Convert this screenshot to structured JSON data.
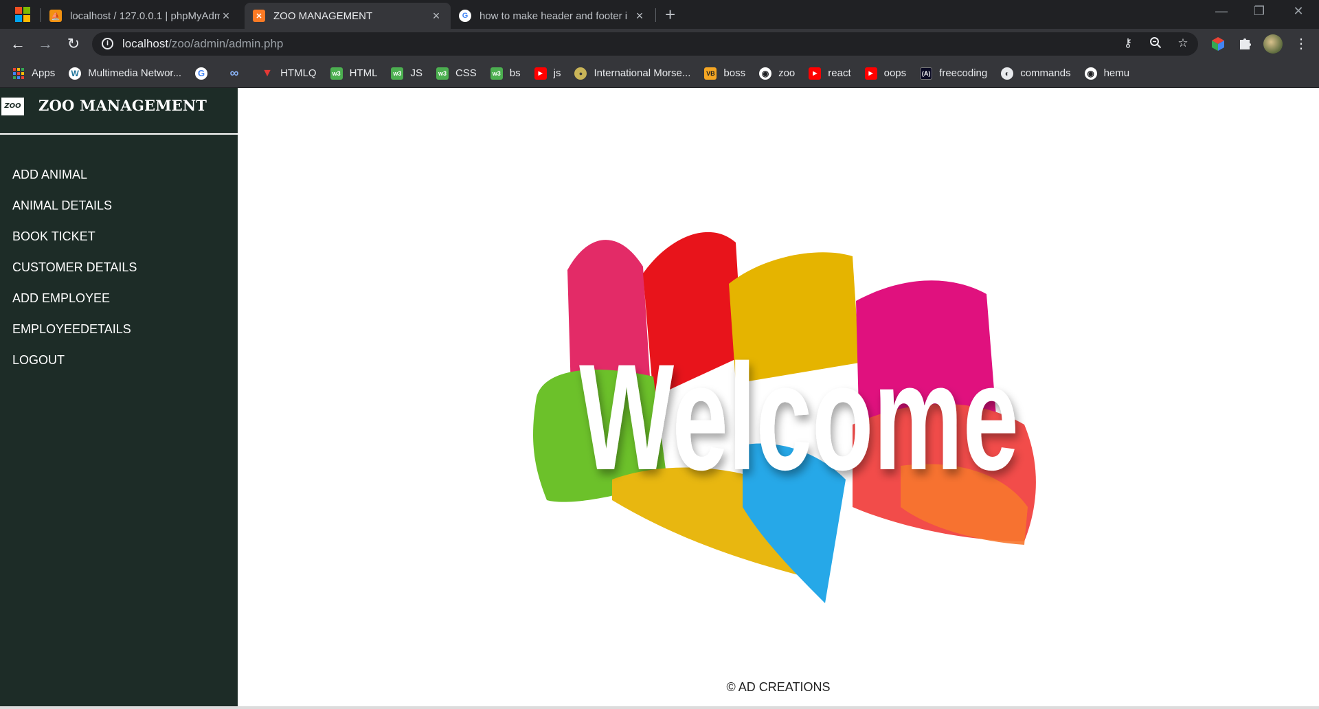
{
  "browser": {
    "tabs": [
      {
        "title": "localhost / 127.0.0.1 | phpMyAdm",
        "icon": "phpmyadmin-icon",
        "active": false
      },
      {
        "title": "ZOO MANAGEMENT",
        "icon": "xampp-icon",
        "active": true
      },
      {
        "title": "how to make header and footer i",
        "icon": "google-icon",
        "active": false
      }
    ],
    "new_tab_label": "+",
    "close_glyph": "×",
    "window_controls": {
      "minimize": "—",
      "restore": "❐",
      "close": "✕"
    },
    "nav": {
      "back": "←",
      "forward": "→",
      "reload": "↻"
    },
    "url": {
      "host": "localhost",
      "path": "/zoo/admin/admin.php"
    },
    "omnibox_icons": [
      "key-icon",
      "zoom-icon",
      "star-icon"
    ],
    "extensions": [
      "extension-cube-icon",
      "puzzle-icon"
    ],
    "menu_glyph": "⋮",
    "bookmarks": [
      {
        "label": "Apps",
        "icon": "apps-grid-icon"
      },
      {
        "label": "Multimedia Networ...",
        "icon": "wordpress-icon"
      },
      {
        "label": "",
        "icon": "google-icon"
      },
      {
        "label": "",
        "icon": "infinity-icon"
      },
      {
        "label": "HTMLQ",
        "icon": "triangle-icon"
      },
      {
        "label": "HTML",
        "icon": "w3-icon"
      },
      {
        "label": "JS",
        "icon": "w3-icon"
      },
      {
        "label": "CSS",
        "icon": "w3-icon"
      },
      {
        "label": "bs",
        "icon": "w3-icon"
      },
      {
        "label": "js",
        "icon": "youtube-icon"
      },
      {
        "label": "International Morse...",
        "icon": "morse-icon"
      },
      {
        "label": "boss",
        "icon": "vb-icon"
      },
      {
        "label": "zoo",
        "icon": "github-icon"
      },
      {
        "label": "react",
        "icon": "youtube-icon"
      },
      {
        "label": "oops",
        "icon": "youtube-icon"
      },
      {
        "label": "freecoding",
        "icon": "freecodecamp-icon"
      },
      {
        "label": "commands",
        "icon": "globe-icon"
      },
      {
        "label": "hemu",
        "icon": "github-icon"
      }
    ]
  },
  "sidebar": {
    "logo_text": "ZOO",
    "title": "ZOO MANAGEMENT",
    "items": [
      {
        "label": "ADD ANIMAL"
      },
      {
        "label": "ANIMAL DETAILS"
      },
      {
        "label": "BOOK TICKET"
      },
      {
        "label": "CUSTOMER DETAILS"
      },
      {
        "label": "ADD EMPLOYEE"
      },
      {
        "label": "EMPLOYEEDETAILS"
      },
      {
        "label": "LOGOUT"
      }
    ]
  },
  "main": {
    "welcome_text": "Welcome",
    "footer": "© AD CREATIONS"
  }
}
